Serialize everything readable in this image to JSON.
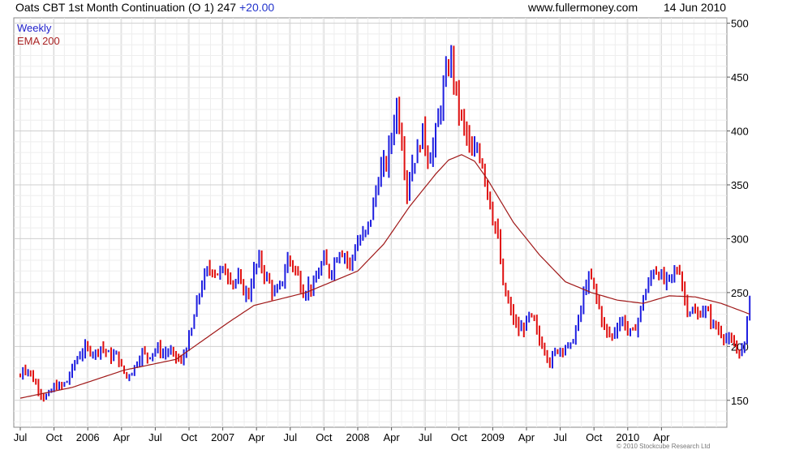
{
  "header": {
    "title": "Oats CBT 1st Month Continuation (O 1) 247",
    "change": "+20.00",
    "site": "www.fullermoney.com",
    "date": "14 Jun 2010"
  },
  "legend": {
    "series1": "Weekly",
    "series2": "EMA 200"
  },
  "copyright": "© 2010 Stockcube Research Ltd",
  "colors": {
    "up": "#1f1fe0",
    "down": "#e01010",
    "ema": "#a01818",
    "grid": "#d8d8d8"
  },
  "chart_data": {
    "type": "line",
    "subtype": "weekly OHLC bars with moving average",
    "title": "Oats CBT 1st Month Continuation (O 1) 247",
    "ylim": [
      125,
      505
    ],
    "y_ticks": [
      150,
      200,
      250,
      300,
      350,
      400,
      450,
      500
    ],
    "y_axis_side": "right",
    "x_ticks": [
      "Jul",
      "Oct",
      "2006",
      "Apr",
      "Jul",
      "Oct",
      "2007",
      "Apr",
      "Jul",
      "Oct",
      "2008",
      "Apr",
      "Jul",
      "Oct",
      "2009",
      "Apr",
      "Jul",
      "Oct",
      "2010",
      "Apr"
    ],
    "x_tick_weeks": [
      0,
      13,
      26,
      39,
      52,
      65,
      78,
      91,
      104,
      117,
      130,
      143,
      156,
      169,
      182,
      195,
      208,
      221,
      234,
      247
    ],
    "total_weeks": 259,
    "grid": true,
    "legend_position": "top-left",
    "series": [
      {
        "name": "Weekly",
        "style": "colored bars (blue up, red down)",
        "anchors_week_close": [
          [
            0,
            172
          ],
          [
            1,
            180
          ],
          [
            3,
            178
          ],
          [
            6,
            165
          ],
          [
            9,
            153
          ],
          [
            11,
            155
          ],
          [
            13,
            163
          ],
          [
            16,
            163
          ],
          [
            18,
            168
          ],
          [
            21,
            185
          ],
          [
            23,
            193
          ],
          [
            25,
            198
          ],
          [
            27,
            196
          ],
          [
            29,
            194
          ],
          [
            31,
            200
          ],
          [
            33,
            195
          ],
          [
            35,
            190
          ],
          [
            37,
            193
          ],
          [
            39,
            180
          ],
          [
            41,
            172
          ],
          [
            43,
            177
          ],
          [
            45,
            186
          ],
          [
            47,
            195
          ],
          [
            49,
            190
          ],
          [
            51,
            195
          ],
          [
            53,
            198
          ],
          [
            55,
            193
          ],
          [
            57,
            196
          ],
          [
            60,
            190
          ],
          [
            62,
            185
          ],
          [
            64,
            200
          ],
          [
            66,
            215
          ],
          [
            68,
            240
          ],
          [
            70,
            258
          ],
          [
            72,
            270
          ],
          [
            74,
            272
          ],
          [
            76,
            268
          ],
          [
            78,
            270
          ],
          [
            80,
            268
          ],
          [
            82,
            260
          ],
          [
            84,
            262
          ],
          [
            86,
            252
          ],
          [
            88,
            248
          ],
          [
            90,
            270
          ],
          [
            92,
            280
          ],
          [
            94,
            268
          ],
          [
            96,
            258
          ],
          [
            98,
            248
          ],
          [
            100,
            255
          ],
          [
            102,
            270
          ],
          [
            103,
            282
          ],
          [
            105,
            275
          ],
          [
            107,
            265
          ],
          [
            109,
            250
          ],
          [
            111,
            256
          ],
          [
            113,
            255
          ],
          [
            115,
            270
          ],
          [
            117,
            280
          ],
          [
            119,
            268
          ],
          [
            121,
            278
          ],
          [
            123,
            290
          ],
          [
            125,
            285
          ],
          [
            127,
            275
          ],
          [
            129,
            292
          ],
          [
            131,
            300
          ],
          [
            133,
            305
          ],
          [
            135,
            320
          ],
          [
            137,
            345
          ],
          [
            139,
            365
          ],
          [
            141,
            370
          ],
          [
            143,
            395
          ],
          [
            145,
            425
          ],
          [
            147,
            390
          ],
          [
            149,
            345
          ],
          [
            151,
            370
          ],
          [
            153,
            380
          ],
          [
            155,
            400
          ],
          [
            157,
            375
          ],
          [
            159,
            385
          ],
          [
            161,
            410
          ],
          [
            163,
            440
          ],
          [
            165,
            460
          ],
          [
            166,
            470
          ],
          [
            168,
            430
          ],
          [
            170,
            410
          ],
          [
            172,
            395
          ],
          [
            174,
            375
          ],
          [
            176,
            385
          ],
          [
            178,
            370
          ],
          [
            180,
            345
          ],
          [
            182,
            320
          ],
          [
            184,
            300
          ],
          [
            186,
            255
          ],
          [
            188,
            240
          ],
          [
            190,
            225
          ],
          [
            192,
            215
          ],
          [
            194,
            218
          ],
          [
            196,
            228
          ],
          [
            198,
            222
          ],
          [
            200,
            205
          ],
          [
            202,
            198
          ],
          [
            204,
            185
          ],
          [
            206,
            195
          ],
          [
            208,
            198
          ],
          [
            210,
            200
          ],
          [
            212,
            200
          ],
          [
            214,
            215
          ],
          [
            216,
            235
          ],
          [
            218,
            260
          ],
          [
            220,
            262
          ],
          [
            222,
            245
          ],
          [
            224,
            225
          ],
          [
            226,
            212
          ],
          [
            228,
            210
          ],
          [
            230,
            220
          ],
          [
            232,
            225
          ],
          [
            234,
            215
          ],
          [
            236,
            212
          ],
          [
            238,
            225
          ],
          [
            240,
            245
          ],
          [
            242,
            258
          ],
          [
            244,
            272
          ],
          [
            246,
            268
          ],
          [
            248,
            260
          ],
          [
            250,
            262
          ],
          [
            252,
            268
          ],
          [
            254,
            272
          ],
          [
            255,
            255
          ],
          [
            257,
            235
          ],
          [
            259,
            232
          ],
          [
            261,
            228
          ],
          [
            263,
            235
          ],
          [
            265,
            230
          ],
          [
            267,
            220
          ],
          [
            269,
            215
          ],
          [
            271,
            210
          ],
          [
            273,
            205
          ],
          [
            275,
            200
          ],
          [
            277,
            195
          ],
          [
            279,
            200
          ],
          [
            280,
            230
          ],
          [
            281,
            247
          ]
        ],
        "max_close": 488,
        "min_close": 152,
        "last_close": 247
      },
      {
        "name": "EMA 200",
        "style": "line",
        "anchors_week_value": [
          [
            0,
            152
          ],
          [
            20,
            162
          ],
          [
            40,
            178
          ],
          [
            60,
            188
          ],
          [
            70,
            205
          ],
          [
            80,
            222
          ],
          [
            90,
            238
          ],
          [
            100,
            244
          ],
          [
            110,
            250
          ],
          [
            120,
            260
          ],
          [
            130,
            270
          ],
          [
            140,
            295
          ],
          [
            150,
            330
          ],
          [
            160,
            360
          ],
          [
            165,
            373
          ],
          [
            170,
            378
          ],
          [
            175,
            372
          ],
          [
            180,
            355
          ],
          [
            190,
            315
          ],
          [
            200,
            285
          ],
          [
            210,
            260
          ],
          [
            220,
            250
          ],
          [
            230,
            243
          ],
          [
            240,
            240
          ],
          [
            250,
            247
          ],
          [
            260,
            246
          ],
          [
            270,
            240
          ],
          [
            281,
            230
          ]
        ]
      }
    ]
  }
}
